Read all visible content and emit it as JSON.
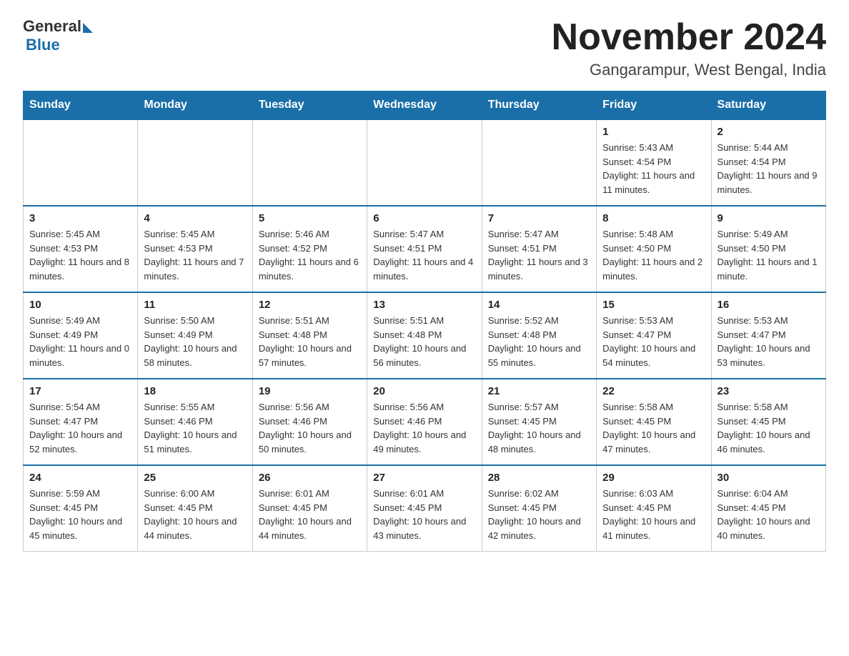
{
  "logo": {
    "general": "General",
    "blue": "Blue"
  },
  "header": {
    "month": "November 2024",
    "location": "Gangarampur, West Bengal, India"
  },
  "days_of_week": [
    "Sunday",
    "Monday",
    "Tuesday",
    "Wednesday",
    "Thursday",
    "Friday",
    "Saturday"
  ],
  "weeks": [
    [
      {
        "day": "",
        "info": ""
      },
      {
        "day": "",
        "info": ""
      },
      {
        "day": "",
        "info": ""
      },
      {
        "day": "",
        "info": ""
      },
      {
        "day": "",
        "info": ""
      },
      {
        "day": "1",
        "info": "Sunrise: 5:43 AM\nSunset: 4:54 PM\nDaylight: 11 hours and 11 minutes."
      },
      {
        "day": "2",
        "info": "Sunrise: 5:44 AM\nSunset: 4:54 PM\nDaylight: 11 hours and 9 minutes."
      }
    ],
    [
      {
        "day": "3",
        "info": "Sunrise: 5:45 AM\nSunset: 4:53 PM\nDaylight: 11 hours and 8 minutes."
      },
      {
        "day": "4",
        "info": "Sunrise: 5:45 AM\nSunset: 4:53 PM\nDaylight: 11 hours and 7 minutes."
      },
      {
        "day": "5",
        "info": "Sunrise: 5:46 AM\nSunset: 4:52 PM\nDaylight: 11 hours and 6 minutes."
      },
      {
        "day": "6",
        "info": "Sunrise: 5:47 AM\nSunset: 4:51 PM\nDaylight: 11 hours and 4 minutes."
      },
      {
        "day": "7",
        "info": "Sunrise: 5:47 AM\nSunset: 4:51 PM\nDaylight: 11 hours and 3 minutes."
      },
      {
        "day": "8",
        "info": "Sunrise: 5:48 AM\nSunset: 4:50 PM\nDaylight: 11 hours and 2 minutes."
      },
      {
        "day": "9",
        "info": "Sunrise: 5:49 AM\nSunset: 4:50 PM\nDaylight: 11 hours and 1 minute."
      }
    ],
    [
      {
        "day": "10",
        "info": "Sunrise: 5:49 AM\nSunset: 4:49 PM\nDaylight: 11 hours and 0 minutes."
      },
      {
        "day": "11",
        "info": "Sunrise: 5:50 AM\nSunset: 4:49 PM\nDaylight: 10 hours and 58 minutes."
      },
      {
        "day": "12",
        "info": "Sunrise: 5:51 AM\nSunset: 4:48 PM\nDaylight: 10 hours and 57 minutes."
      },
      {
        "day": "13",
        "info": "Sunrise: 5:51 AM\nSunset: 4:48 PM\nDaylight: 10 hours and 56 minutes."
      },
      {
        "day": "14",
        "info": "Sunrise: 5:52 AM\nSunset: 4:48 PM\nDaylight: 10 hours and 55 minutes."
      },
      {
        "day": "15",
        "info": "Sunrise: 5:53 AM\nSunset: 4:47 PM\nDaylight: 10 hours and 54 minutes."
      },
      {
        "day": "16",
        "info": "Sunrise: 5:53 AM\nSunset: 4:47 PM\nDaylight: 10 hours and 53 minutes."
      }
    ],
    [
      {
        "day": "17",
        "info": "Sunrise: 5:54 AM\nSunset: 4:47 PM\nDaylight: 10 hours and 52 minutes."
      },
      {
        "day": "18",
        "info": "Sunrise: 5:55 AM\nSunset: 4:46 PM\nDaylight: 10 hours and 51 minutes."
      },
      {
        "day": "19",
        "info": "Sunrise: 5:56 AM\nSunset: 4:46 PM\nDaylight: 10 hours and 50 minutes."
      },
      {
        "day": "20",
        "info": "Sunrise: 5:56 AM\nSunset: 4:46 PM\nDaylight: 10 hours and 49 minutes."
      },
      {
        "day": "21",
        "info": "Sunrise: 5:57 AM\nSunset: 4:45 PM\nDaylight: 10 hours and 48 minutes."
      },
      {
        "day": "22",
        "info": "Sunrise: 5:58 AM\nSunset: 4:45 PM\nDaylight: 10 hours and 47 minutes."
      },
      {
        "day": "23",
        "info": "Sunrise: 5:58 AM\nSunset: 4:45 PM\nDaylight: 10 hours and 46 minutes."
      }
    ],
    [
      {
        "day": "24",
        "info": "Sunrise: 5:59 AM\nSunset: 4:45 PM\nDaylight: 10 hours and 45 minutes."
      },
      {
        "day": "25",
        "info": "Sunrise: 6:00 AM\nSunset: 4:45 PM\nDaylight: 10 hours and 44 minutes."
      },
      {
        "day": "26",
        "info": "Sunrise: 6:01 AM\nSunset: 4:45 PM\nDaylight: 10 hours and 44 minutes."
      },
      {
        "day": "27",
        "info": "Sunrise: 6:01 AM\nSunset: 4:45 PM\nDaylight: 10 hours and 43 minutes."
      },
      {
        "day": "28",
        "info": "Sunrise: 6:02 AM\nSunset: 4:45 PM\nDaylight: 10 hours and 42 minutes."
      },
      {
        "day": "29",
        "info": "Sunrise: 6:03 AM\nSunset: 4:45 PM\nDaylight: 10 hours and 41 minutes."
      },
      {
        "day": "30",
        "info": "Sunrise: 6:04 AM\nSunset: 4:45 PM\nDaylight: 10 hours and 40 minutes."
      }
    ]
  ]
}
